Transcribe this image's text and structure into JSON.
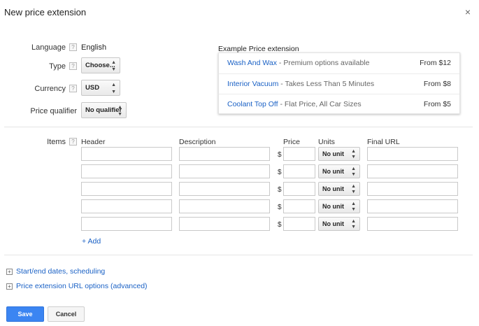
{
  "dialog": {
    "title": "New price extension",
    "close_icon": "×"
  },
  "form": {
    "language_label": "Language",
    "language_value": "English",
    "type_label": "Type",
    "type_value": "Choose...",
    "currency_label": "Currency",
    "currency_value": "USD",
    "qualifier_label": "Price qualifier",
    "qualifier_value": "No qualifier",
    "help_glyph": "?",
    "select_arrow": "▲▼"
  },
  "example": {
    "title": "Example Price extension",
    "rows": [
      {
        "header": "Wash And Wax",
        "sep": " - ",
        "description": "Premium options available",
        "price": "From $12"
      },
      {
        "header": "Interior Vacuum",
        "sep": " - ",
        "description": "Takes Less Than 5 Minutes",
        "price": "From $8"
      },
      {
        "header": "Coolant Top Off",
        "sep": " - ",
        "description": "Flat Price, All Car Sizes",
        "price": "From $5"
      }
    ]
  },
  "items": {
    "label": "Items",
    "columns": {
      "header": "Header",
      "description": "Description",
      "price": "Price",
      "units": "Units",
      "final_url": "Final URL"
    },
    "currency_symbol": "$",
    "rows": [
      {
        "header": "",
        "description": "",
        "price": "",
        "unit": "No unit",
        "final_url": ""
      },
      {
        "header": "",
        "description": "",
        "price": "",
        "unit": "No unit",
        "final_url": ""
      },
      {
        "header": "",
        "description": "",
        "price": "",
        "unit": "No unit",
        "final_url": ""
      },
      {
        "header": "",
        "description": "",
        "price": "",
        "unit": "No unit",
        "final_url": ""
      },
      {
        "header": "",
        "description": "",
        "price": "",
        "unit": "No unit",
        "final_url": ""
      }
    ],
    "add_label": "+ Add"
  },
  "sections": {
    "scheduling": "Start/end dates, scheduling",
    "url_options": "Price extension URL options (advanced)",
    "expand_glyph": "+"
  },
  "actions": {
    "save": "Save",
    "cancel": "Cancel"
  },
  "colors": {
    "link": "#1a61c5",
    "primary_button": "#3b85f2"
  }
}
